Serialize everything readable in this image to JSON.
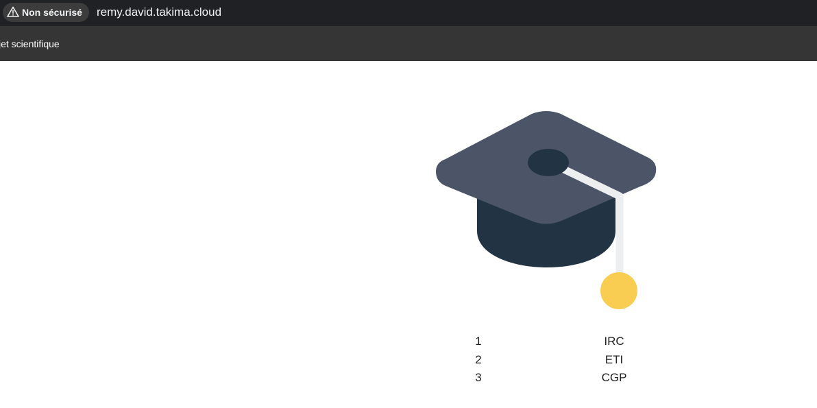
{
  "browser": {
    "security_label": "Non sécurisé",
    "security_icon": "warning-triangle-icon",
    "url": "remy.david.takima.cloud"
  },
  "bookmarks": {
    "items": [
      {
        "label": "jet scientifique"
      }
    ]
  },
  "main": {
    "illustration": {
      "icon": "graduation-cap-icon",
      "colors": {
        "board": "#4b5567",
        "band": "#223443",
        "button": "#223443",
        "cord": "#eceef0",
        "tassel": "#f9cd51"
      }
    },
    "schools": [
      {
        "rank": "1",
        "name": "IRC"
      },
      {
        "rank": "2",
        "name": "ETI"
      },
      {
        "rank": "3",
        "name": "CGP"
      }
    ]
  }
}
